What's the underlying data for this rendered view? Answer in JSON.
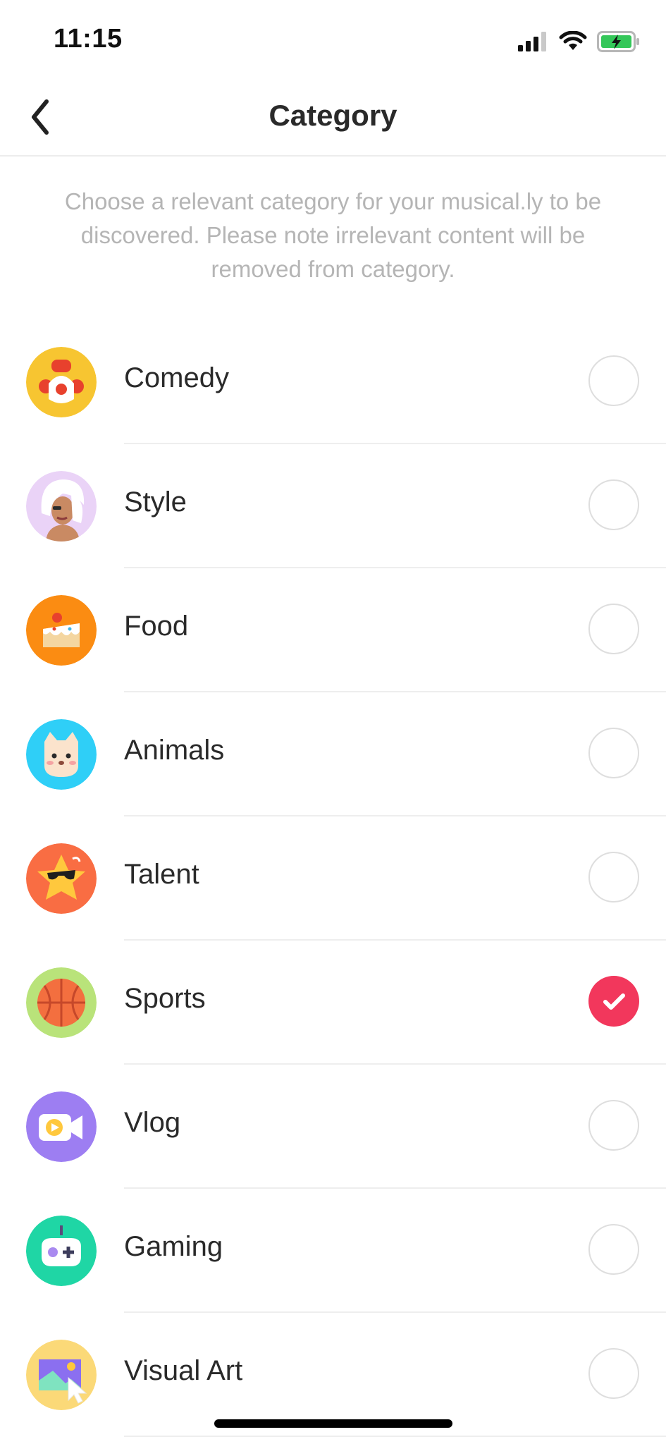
{
  "status_bar": {
    "time": "11:15"
  },
  "header": {
    "title": "Category"
  },
  "description": "Choose a relevant category for your musical.ly to be discovered. Please note irrelevant content will be removed from category.",
  "categories": [
    {
      "label": "Comedy",
      "icon": "clown-icon",
      "color": "#f7c531",
      "selected": false
    },
    {
      "label": "Style",
      "icon": "fashion-woman-icon",
      "color": "#ead3f7",
      "selected": false
    },
    {
      "label": "Food",
      "icon": "cake-icon",
      "color": "#fb8c12",
      "selected": false
    },
    {
      "label": "Animals",
      "icon": "cat-icon",
      "color": "#2fcff7",
      "selected": false
    },
    {
      "label": "Talent",
      "icon": "star-sunglasses-icon",
      "color": "#f96d43",
      "selected": false
    },
    {
      "label": "Sports",
      "icon": "basketball-icon",
      "color": "#b9e37a",
      "selected": true
    },
    {
      "label": "Vlog",
      "icon": "video-camera-icon",
      "color": "#9d7ef2",
      "selected": false
    },
    {
      "label": "Gaming",
      "icon": "gamepad-icon",
      "color": "#1fd6a5",
      "selected": false
    },
    {
      "label": "Visual Art",
      "icon": "picture-cursor-icon",
      "color": "#fbd978",
      "selected": false
    }
  ],
  "colors": {
    "accent": "#f2375c",
    "divider": "#eeeeee",
    "description_text": "#b5b5b5"
  }
}
